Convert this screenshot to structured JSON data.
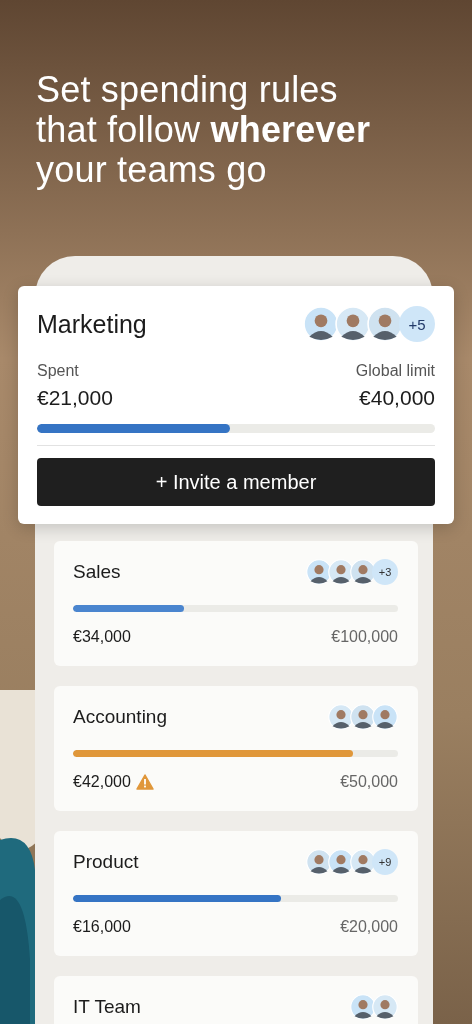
{
  "headline": "Set spending rules that follow **wherever** your teams go",
  "featured_team": {
    "name": "Marketing",
    "members": [
      {
        "kind": "avatar"
      },
      {
        "kind": "avatar"
      },
      {
        "kind": "avatar"
      }
    ],
    "more": "+5",
    "spent_label": "Spent",
    "spent": "€21,000",
    "limit_label": "Global limit",
    "limit": "€40,000",
    "level": 0.485,
    "color": "#3574c4",
    "button": "+ Invite a member"
  },
  "teams": [
    {
      "name": "Sales",
      "members": [
        {
          "kind": "avatar"
        },
        {
          "kind": "avatar"
        },
        {
          "kind": "avatar"
        }
      ],
      "more": "+3",
      "level": 0.34,
      "color": "#4a85cf",
      "spent": "€34,000",
      "warning": false,
      "limit": "€100,000"
    },
    {
      "name": "Accounting",
      "members": [
        {
          "kind": "avatar"
        },
        {
          "kind": "avatar"
        },
        {
          "kind": "avatar"
        }
      ],
      "level": 0.86,
      "color": "#e0973a",
      "spent": "€42,000",
      "warning": true,
      "limit": "€50,000"
    },
    {
      "name": "Product",
      "members": [
        {
          "kind": "avatar"
        },
        {
          "kind": "avatar"
        },
        {
          "kind": "avatar"
        }
      ],
      "more": "+9",
      "level": 0.64,
      "color": "#3574c4",
      "spent": "€16,000",
      "warning": false,
      "limit": "€20,000"
    },
    {
      "name": "IT Team",
      "members": [
        {
          "kind": "avatar"
        },
        {
          "kind": "avatar"
        }
      ]
    }
  ]
}
